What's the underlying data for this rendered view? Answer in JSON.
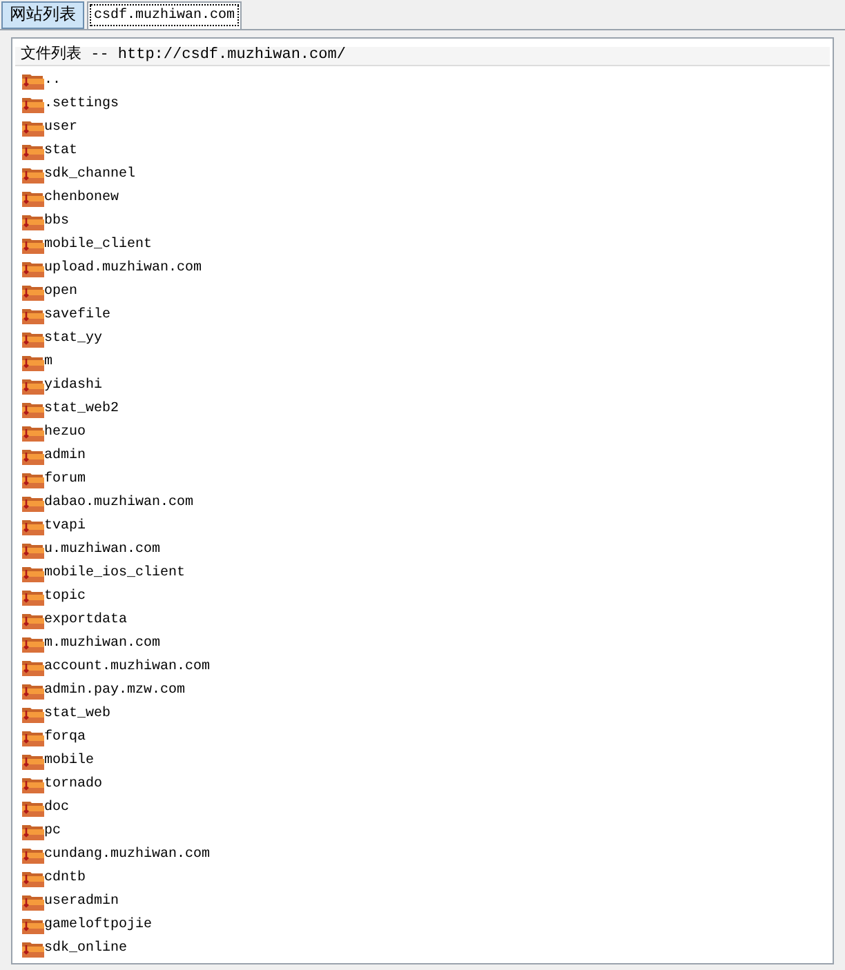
{
  "tabs": [
    {
      "label": "网站列表",
      "selected": false
    },
    {
      "label": "csdf.muzhiwan.com",
      "selected": true
    }
  ],
  "file_list": {
    "title": "文件列表 -- http://csdf.muzhiwan.com/",
    "items": [
      "..",
      ".settings",
      "user",
      "stat",
      "sdk_channel",
      "chenbonew",
      "bbs",
      "mobile_client",
      "upload.muzhiwan.com",
      "open",
      "savefile",
      "stat_yy",
      "m",
      "yidashi",
      "stat_web2",
      "hezuo",
      "admin",
      "forum",
      "dabao.muzhiwan.com",
      "tvapi",
      "u.muzhiwan.com",
      "mobile_ios_client",
      "topic",
      "exportdata",
      "m.muzhiwan.com",
      "account.muzhiwan.com",
      "admin.pay.mzw.com",
      "stat_web",
      "forqa",
      "mobile",
      "tornado",
      "doc",
      "pc",
      "cundang.muzhiwan.com",
      "cdntb",
      "useradmin",
      "gameloftpojie",
      "sdk_online"
    ]
  }
}
